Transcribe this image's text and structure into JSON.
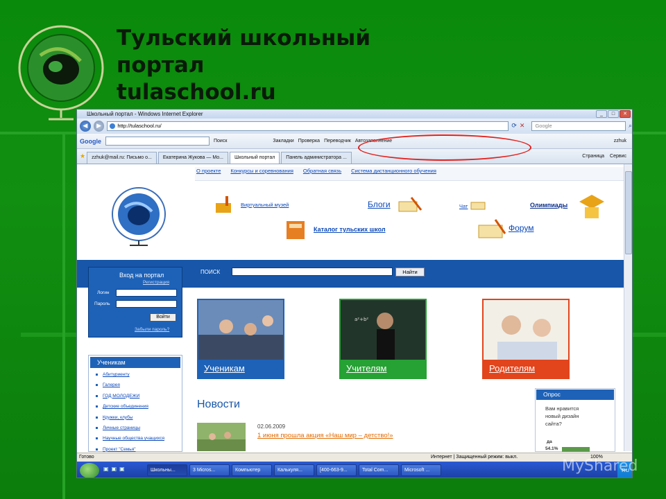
{
  "slide": {
    "title": "Тульский школьный\nпортал\ntulaschool.ru",
    "watermark": "MyShared"
  },
  "browser": {
    "window_title": "Школьный портал - Windows Internet Explorer",
    "address": "http://tulaschool.ru/",
    "search_placeholder": "Google",
    "toolbar": {
      "brand": "Google",
      "search_btn": "Поиск",
      "bookmarks": "Закладки",
      "check": "Проверка",
      "translate": "Переводчик",
      "autofill": "Автозаполнение",
      "user": "zzhuk"
    },
    "tabs": [
      {
        "label": "zzhuk@mail.ru: Письмо о..."
      },
      {
        "label": "Екатерина Жукова — Мо..."
      },
      {
        "label": "Школьный портал"
      },
      {
        "label": "Панель администратора ..."
      }
    ],
    "tab_tools": {
      "page": "Страница",
      "service": "Сервис"
    }
  },
  "site": {
    "topnav": [
      "О проекте",
      "Конкурсы и соревнования",
      "Обратная связь",
      "Система дистанционного обучения"
    ],
    "links": {
      "museum": "Виртуальный музей",
      "blogs": "Блоги",
      "chat": "Чат",
      "olympiads": "Олимпиады",
      "catalog": "Каталог тульских школ",
      "forum": "Форум"
    },
    "search": {
      "label": "ПОИСК",
      "button": "Найти"
    },
    "login": {
      "title": "Вход на портал",
      "register": "Регистрация",
      "login_label": "Логин",
      "password_label": "Пароль",
      "button": "Войти",
      "forgot": "Забыли пароль?"
    },
    "cards": [
      {
        "caption": "Ученикам",
        "color": "#1e62b8"
      },
      {
        "caption": "Учителям",
        "color": "#26a134"
      },
      {
        "caption": "Родителям",
        "color": "#e2441c"
      }
    ],
    "menu": {
      "header": "Ученикам",
      "items": [
        "Абитуриенту",
        "Галерея",
        "ГОД МОЛОДЕЖИ",
        "Детские объединения",
        "Кружки, клубы",
        "Личные страницы",
        "Научные общества учащихся",
        "Проект \"Семья\""
      ]
    },
    "news": {
      "title": "Новости",
      "date": "02.06.2009",
      "headline": "1 июня прошла акция «Наш мир – детство!»"
    },
    "poll": {
      "header": "Опрос",
      "question": "Вам нравится\nновый дизайн\nсайта?",
      "answer": "да",
      "percent": "54.1%",
      "share": 0.541
    }
  },
  "statusbar": {
    "left": "Готово",
    "mode": "Интернет | Защищенный режим: выкл.",
    "zoom": "100%"
  },
  "taskbar": {
    "items": [
      "Школьны...",
      "3 Micros...",
      "Компьютер",
      "Калькуля...",
      "[400-663-9...",
      "Total Com...",
      "Microsoft ..."
    ],
    "lang": "RU"
  }
}
